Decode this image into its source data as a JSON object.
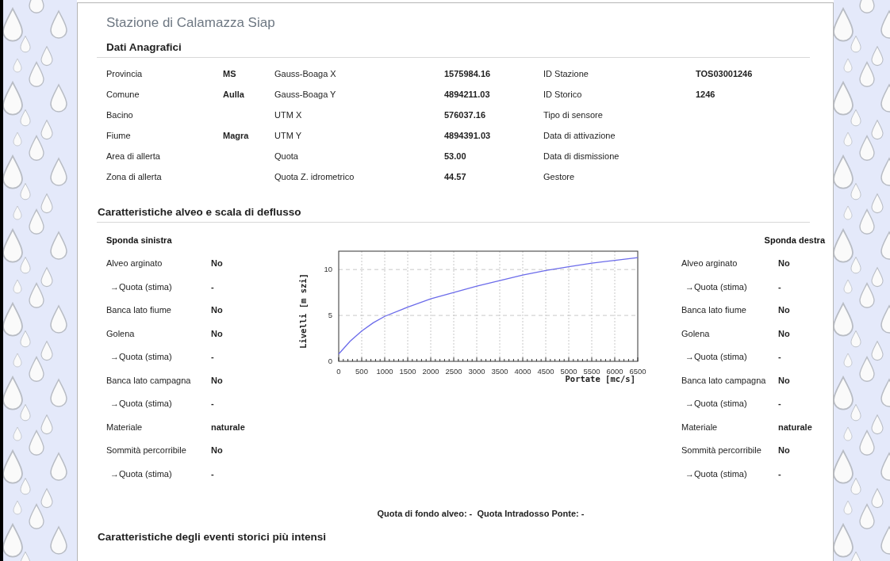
{
  "title": "Stazione di Calamazza Siap",
  "anagrafica": {
    "heading": "Dati Anagrafici",
    "rows": [
      [
        {
          "label": "Provincia",
          "value": "MS"
        },
        {
          "label": "Gauss-Boaga X",
          "value": "1575984.16"
        },
        {
          "label": "ID Stazione",
          "value": "TOS03001246"
        }
      ],
      [
        {
          "label": "Comune",
          "value": "Aulla"
        },
        {
          "label": "Gauss-Boaga Y",
          "value": "4894211.03"
        },
        {
          "label": "ID Storico",
          "value": "1246"
        }
      ],
      [
        {
          "label": "Bacino"
        },
        {
          "label": "UTM X",
          "value": "576037.16"
        },
        {
          "label": "Tipo di sensore"
        }
      ],
      [
        {
          "label": "Fiume",
          "value": "Magra"
        },
        {
          "label": "UTM Y",
          "value": "4894391.03"
        },
        {
          "label": "Data di attivazione"
        }
      ],
      [
        {
          "label": "Area di allerta"
        },
        {
          "label": "Quota",
          "value": "53.00"
        },
        {
          "label": "Data di dismissione"
        }
      ],
      [
        {
          "label": "Zona di allerta"
        },
        {
          "label": "Quota Z. idrometrico",
          "value": "44.57"
        },
        {
          "label": "Gestore"
        }
      ]
    ]
  },
  "alveo": {
    "heading": "Caratteristiche alveo e scala di deflusso",
    "left": {
      "title": "Sponda sinistra",
      "rows": [
        {
          "label": "Alveo arginato",
          "value": "No",
          "sub": false
        },
        {
          "label": "→Quota (stima)",
          "value": "-",
          "sub": true
        },
        {
          "label": "Banca lato fiume",
          "value": "No",
          "sub": false
        },
        {
          "label": "Golena",
          "value": "No",
          "sub": false
        },
        {
          "label": "→Quota (stima)",
          "value": "-",
          "sub": true
        },
        {
          "label": "Banca lato campagna",
          "value": "No",
          "sub": false
        },
        {
          "label": "→Quota (stima)",
          "value": "-",
          "sub": true
        },
        {
          "label": "Materiale",
          "value": "naturale",
          "sub": false
        },
        {
          "label": "Sommità percorribile",
          "value": "No",
          "sub": false
        },
        {
          "label": "→Quota (stima)",
          "value": "-",
          "sub": true
        }
      ]
    },
    "right": {
      "title": "Sponda destra",
      "rows": [
        {
          "label": "Alveo arginato",
          "value": "No",
          "sub": false
        },
        {
          "label": "→Quota (stima)",
          "value": "-",
          "sub": true
        },
        {
          "label": "Banca lato fiume",
          "value": "No",
          "sub": false
        },
        {
          "label": "Golena",
          "value": "No",
          "sub": false
        },
        {
          "label": "→Quota (stima)",
          "value": "-",
          "sub": true
        },
        {
          "label": "Banca lato campagna",
          "value": "No",
          "sub": false
        },
        {
          "label": "→Quota (stima)",
          "value": "-",
          "sub": true
        },
        {
          "label": "Materiale",
          "value": "naturale",
          "sub": false
        },
        {
          "label": "Sommità percorribile",
          "value": "No",
          "sub": false
        },
        {
          "label": "→Quota (stima)",
          "value": "-",
          "sub": true
        }
      ]
    },
    "chart_data": {
      "type": "line",
      "xlabel": "Portate [mc/s]",
      "ylabel": "Livelli [m szi]",
      "x": [
        0,
        250,
        500,
        750,
        1000,
        1500,
        2000,
        2500,
        3000,
        3500,
        4000,
        4500,
        5000,
        5500,
        6000,
        6500
      ],
      "grid": true,
      "series": [
        {
          "color": "#6b6bea",
          "values": [
            0.8,
            2.2,
            3.3,
            4.2,
            4.9,
            5.9,
            6.8,
            7.5,
            8.2,
            8.8,
            9.4,
            9.9,
            10.3,
            10.7,
            11.0,
            11.3
          ]
        }
      ],
      "xlim": [
        0,
        6500
      ],
      "ylim": [
        0,
        12
      ],
      "xticks": [
        0,
        500,
        1000,
        1500,
        2000,
        2500,
        3000,
        3500,
        4000,
        4500,
        5000,
        5500,
        6000,
        6500
      ],
      "yticks": [
        0,
        5,
        10
      ]
    },
    "footer": "Quota di fondo alveo: -  Quota Intradosso Ponte: -"
  },
  "eventi": {
    "heading": "Caratteristiche degli eventi storici più intensi"
  }
}
